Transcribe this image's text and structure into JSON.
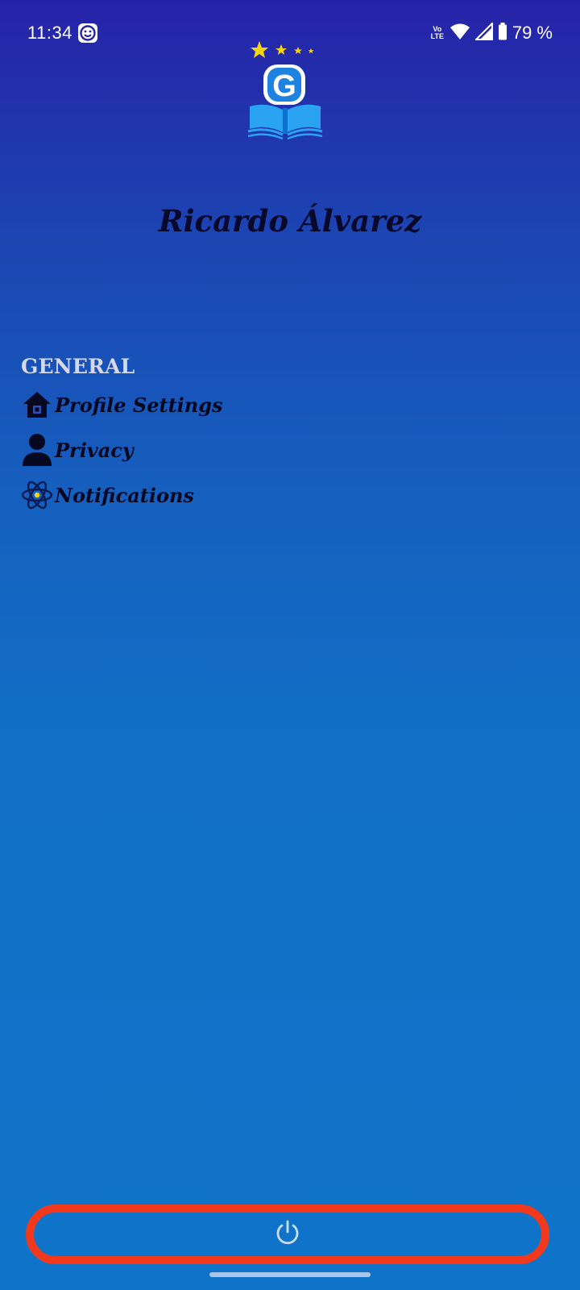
{
  "status_bar": {
    "time": "11:34",
    "battery_percent": "79 %",
    "network_label_top": "Vo",
    "network_label_bottom": "LTE",
    "icons": [
      "smile-app-icon",
      "wifi-icon",
      "cell-signal-icon",
      "battery-icon"
    ]
  },
  "app": {
    "logo_letter": "G",
    "logo_icon": "book-stars-logo"
  },
  "profile": {
    "name": "Ricardo Álvarez"
  },
  "menu": {
    "section_title": "GENERAL",
    "items": [
      {
        "label": "Profile Settings",
        "icon": "home-icon"
      },
      {
        "label": "Privacy",
        "icon": "person-icon"
      },
      {
        "label": "Notifications",
        "icon": "atom-icon"
      }
    ]
  },
  "footer": {
    "logout_icon": "power-icon",
    "highlight_color": "#f2391c"
  },
  "colors": {
    "gradient_top": "#2622a8",
    "gradient_bottom": "#0f74c9",
    "accent_star": "#f5d40f"
  }
}
